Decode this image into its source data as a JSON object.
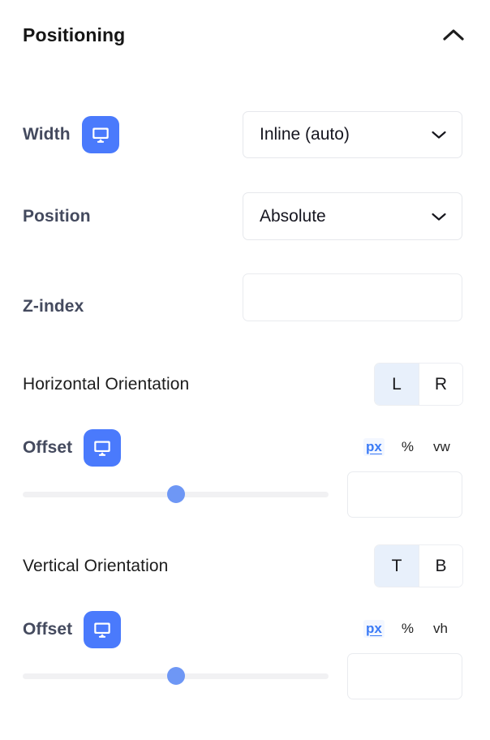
{
  "panel": {
    "title": "Positioning",
    "collapse_icon": "chevron-up-icon"
  },
  "accent": {
    "blue": "#4a7afc",
    "link_blue": "#3b7bf6",
    "seg_active_bg": "#e8f0fb",
    "slider_thumb": "#6e97f5",
    "slider_track": "#f1f1f3",
    "label_strong": "#444a5e",
    "label_plain": "#1c1c1c"
  },
  "width_row": {
    "label": "Width",
    "device_icon": "desktop-monitor-icon",
    "select_value": "Inline (auto)",
    "chevron_icon": "chevron-down-icon"
  },
  "position_row": {
    "label": "Position",
    "select_value": "Absolute",
    "chevron_icon": "chevron-down-icon"
  },
  "zindex_row": {
    "label": "Z-index",
    "value": "",
    "placeholder": ""
  },
  "horizontal_orientation": {
    "label": "Horizontal Orientation",
    "options": [
      "L",
      "R"
    ],
    "selected": "L"
  },
  "horizontal_offset": {
    "label": "Offset",
    "device_icon": "desktop-monitor-icon",
    "units": [
      "px",
      "%",
      "vw"
    ],
    "selected_unit": "px",
    "slider_percent": 50,
    "value": "",
    "placeholder": ""
  },
  "vertical_orientation": {
    "label": "Vertical Orientation",
    "options": [
      "T",
      "B"
    ],
    "selected": "T"
  },
  "vertical_offset": {
    "label": "Offset",
    "device_icon": "desktop-monitor-icon",
    "units": [
      "px",
      "%",
      "vh"
    ],
    "selected_unit": "px",
    "slider_percent": 50,
    "value": "",
    "placeholder": ""
  }
}
